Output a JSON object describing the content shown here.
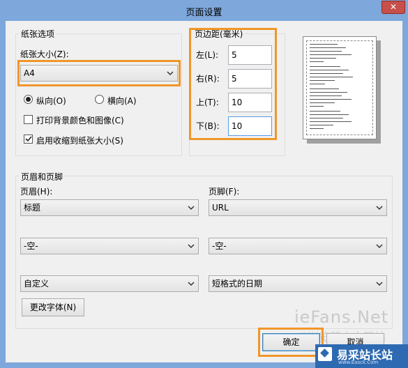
{
  "window": {
    "title": "页面设置",
    "close_glyph": "✕"
  },
  "paper": {
    "group_title": "纸张选项",
    "size_label": "纸张大小(Z):",
    "size_value": "A4",
    "portrait_label": "纵向(O)",
    "landscape_label": "横向(A)",
    "portrait_selected": true,
    "print_background_label": "打印背景颜色和图像(C)",
    "print_background_checked": false,
    "shrink_to_fit_label": "启用收缩到纸张大小(S)",
    "shrink_to_fit_checked": true
  },
  "margins": {
    "group_title": "页边距(毫米)",
    "left_label": "左(L):",
    "left_value": "5",
    "right_label": "右(R):",
    "right_value": "5",
    "top_label": "上(T):",
    "top_value": "10",
    "bottom_label": "下(B):",
    "bottom_value": "10"
  },
  "header_footer": {
    "group_title": "页眉和页脚",
    "header_label": "页眉(H):",
    "footer_label": "页脚(F):",
    "header_rows": [
      "标题",
      "-空-",
      "自定义"
    ],
    "footer_rows": [
      "URL",
      "-空-",
      "短格式的日期"
    ],
    "change_font_label": "更改字体(N)"
  },
  "buttons": {
    "ok_label": "确定",
    "cancel_label": "取消"
  },
  "watermark": {
    "site_name": "ieFans.Net",
    "site_subtitle": "IE浏览器中文网站",
    "logo_text": "易采站长站",
    "logo_url": "www.Easck.Com"
  },
  "colors": {
    "highlight": "#f0962a",
    "titlebar": "#7ea8dc",
    "close_button": "#c7504a",
    "focus_border": "#569de5"
  },
  "icons": {
    "dropdown": "chevron-down-icon",
    "close": "close-icon",
    "checkbox": "checkmark-icon"
  }
}
